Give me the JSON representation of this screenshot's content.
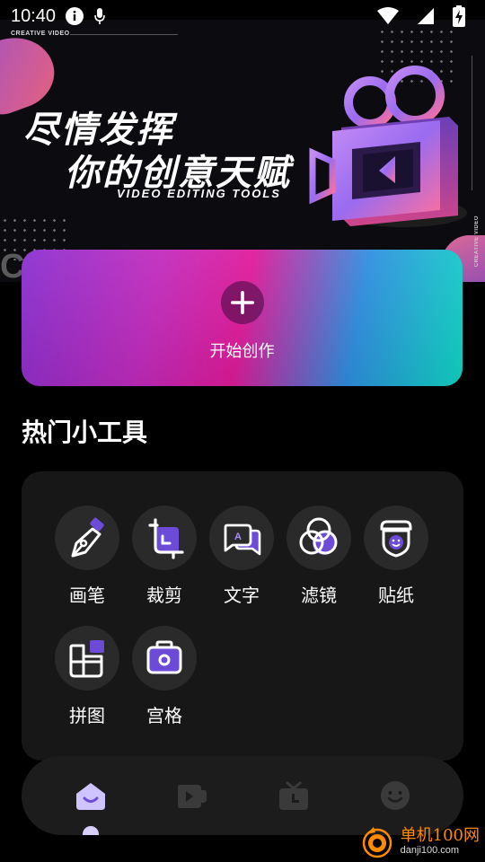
{
  "status_bar": {
    "time": "10:40",
    "icons": [
      "info-icon",
      "mic-icon",
      "wifi-icon",
      "signal-icon",
      "battery-charging-icon"
    ]
  },
  "banner": {
    "small_label": "CREATIVE VIDEO",
    "vertical_label": "CREATIVE VIDEO",
    "title_line1": "尽情发挥",
    "title_line2": "你的创意天赋",
    "subtitle": "VIDEO EDITING TOOLS",
    "partial_text": "CR",
    "illustration": "video-camera-3d-icon"
  },
  "start_card": {
    "label": "开始创作",
    "icon": "plus-icon"
  },
  "section": {
    "title": "热门小工具"
  },
  "tools": [
    {
      "label": "画笔",
      "icon": "brush-pen-icon"
    },
    {
      "label": "裁剪",
      "icon": "crop-icon"
    },
    {
      "label": "文字",
      "icon": "text-bubble-icon"
    },
    {
      "label": "滤镜",
      "icon": "filter-circles-icon"
    },
    {
      "label": "贴纸",
      "icon": "sticker-icon"
    },
    {
      "label": "拼图",
      "icon": "collage-icon"
    },
    {
      "label": "宫格",
      "icon": "grid-camera-icon"
    }
  ],
  "bottom_nav": [
    {
      "icon": "home-icon",
      "active": true
    },
    {
      "icon": "video-play-icon",
      "active": false
    },
    {
      "icon": "tv-icon",
      "active": false
    },
    {
      "icon": "smiley-icon",
      "active": false
    }
  ],
  "watermark": {
    "title": "单机100网",
    "url": "danji100.com"
  },
  "colors": {
    "accent_purple": "#6c4bd8",
    "icon_bg": "#2a2a2a",
    "panel_bg": "#171717",
    "nav_bg": "#1c1c1c"
  }
}
